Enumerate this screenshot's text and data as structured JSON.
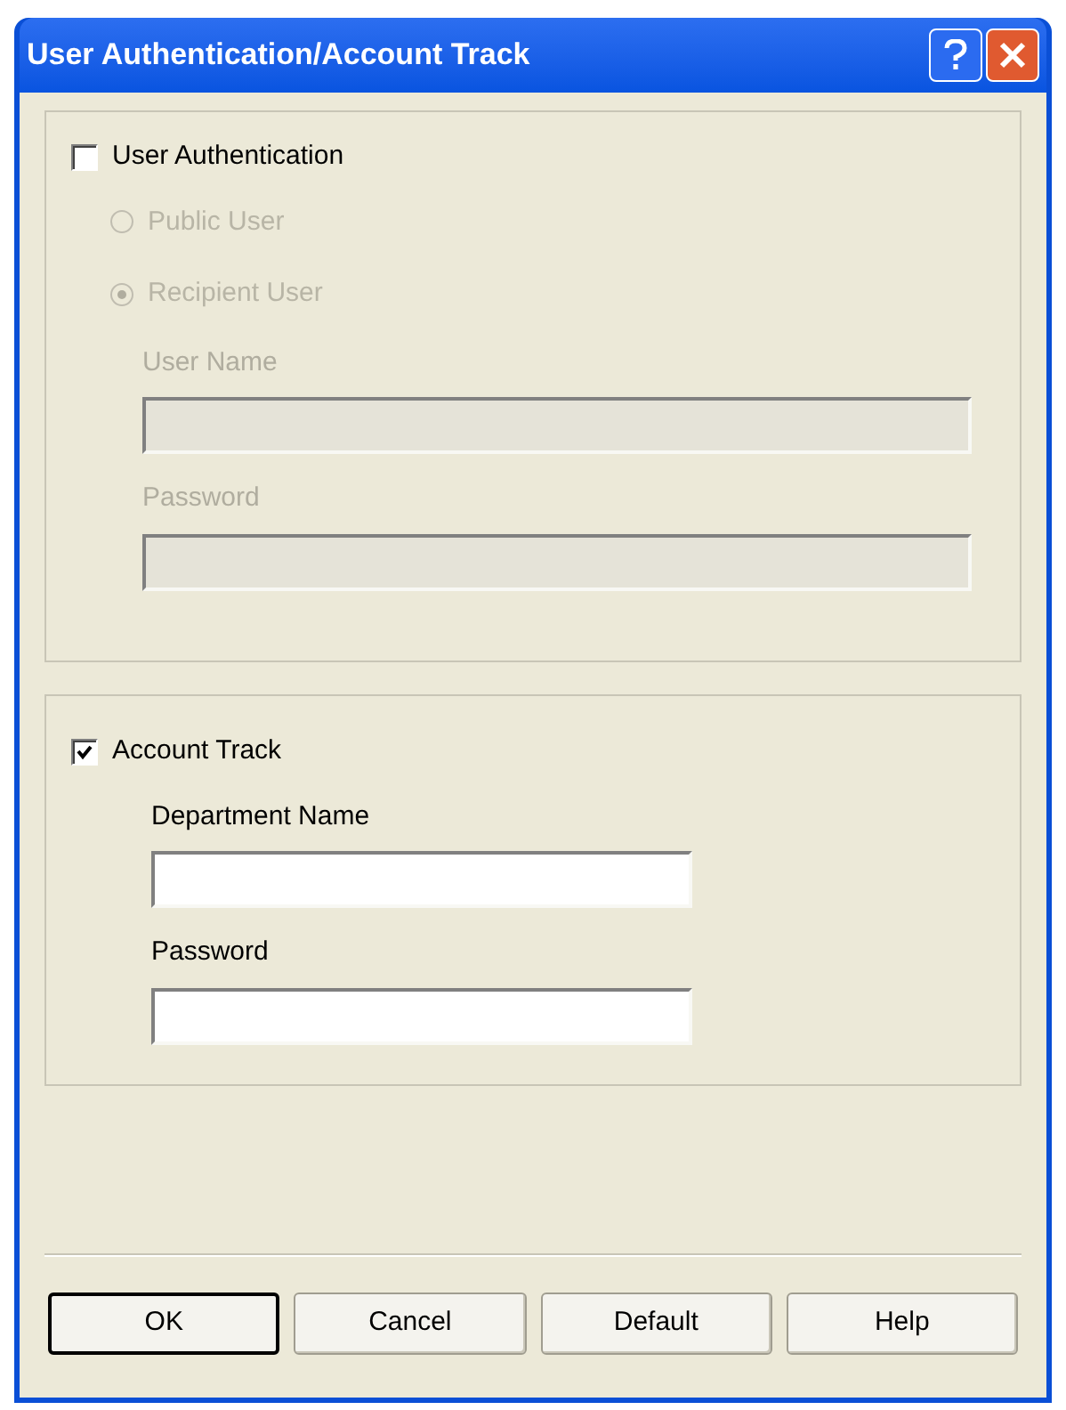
{
  "window": {
    "title": "User Authentication/Account Track"
  },
  "user_authentication": {
    "label": "User Authentication",
    "checked": false,
    "options": [
      {
        "label": "Public User",
        "selected": false,
        "disabled": true
      },
      {
        "label": "Recipient User",
        "selected": true,
        "disabled": true
      }
    ],
    "fields": [
      {
        "label": "User Name",
        "disabled": true
      },
      {
        "label": "Password",
        "disabled": true
      }
    ]
  },
  "account_track": {
    "label": "Account Track",
    "checked": true,
    "fields": [
      {
        "label": "Department Name",
        "disabled": false
      },
      {
        "label": "Password",
        "disabled": false
      }
    ]
  },
  "buttons": [
    {
      "label": "OK",
      "default": true
    },
    {
      "label": "Cancel",
      "default": false
    },
    {
      "label": "Default",
      "default": false
    },
    {
      "label": "Help",
      "default": false
    }
  ]
}
